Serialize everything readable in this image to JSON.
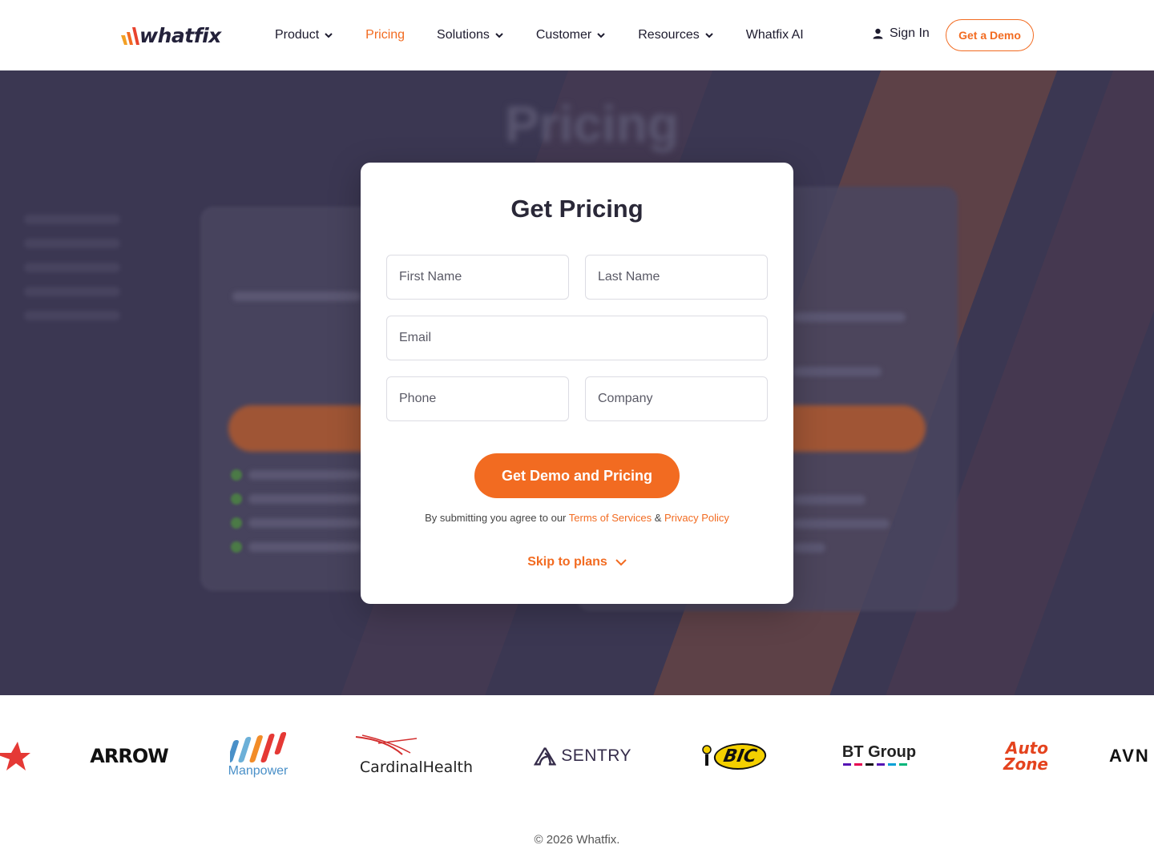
{
  "header": {
    "logo_text": "whatfix",
    "nav": [
      {
        "label": "Product",
        "dropdown": true,
        "active": false
      },
      {
        "label": "Pricing",
        "dropdown": false,
        "active": true
      },
      {
        "label": "Solutions",
        "dropdown": true,
        "active": false
      },
      {
        "label": "Customer",
        "dropdown": true,
        "active": false
      },
      {
        "label": "Resources",
        "dropdown": true,
        "active": false
      },
      {
        "label": "Whatfix AI",
        "dropdown": false,
        "active": false
      }
    ],
    "sign_in": "Sign In",
    "get_demo": "Get a Demo"
  },
  "hero": {
    "background_title": "Pricing"
  },
  "modal": {
    "title": "Get Pricing",
    "fields": {
      "first_name": {
        "placeholder": "First Name",
        "value": ""
      },
      "last_name": {
        "placeholder": "Last Name",
        "value": ""
      },
      "email": {
        "placeholder": "Email",
        "value": ""
      },
      "phone": {
        "placeholder": "Phone",
        "value": ""
      },
      "company": {
        "placeholder": "Company",
        "value": ""
      }
    },
    "submit_label": "Get Demo and Pricing",
    "consent_prefix": "By submitting you agree to our",
    "terms_label": "Terms of Services",
    "consent_and": "&",
    "privacy_label": "Privacy Policy",
    "skip_label": "Skip to plans"
  },
  "clients": {
    "arrow": "ARROW",
    "manpower": "Manpower",
    "cardinal": "CardinalHealth",
    "sentry": "SENTRY",
    "bic": "BIC",
    "bt": "BT Group",
    "autozone_1": "Auto",
    "autozone_2": "Zone",
    "avn": "AVN"
  },
  "footer": {
    "copyright": "© 2026 Whatfix."
  },
  "colors": {
    "accent": "#f26b21",
    "hero_bg": "#3b3752",
    "text_dark": "#1d1b2e"
  }
}
